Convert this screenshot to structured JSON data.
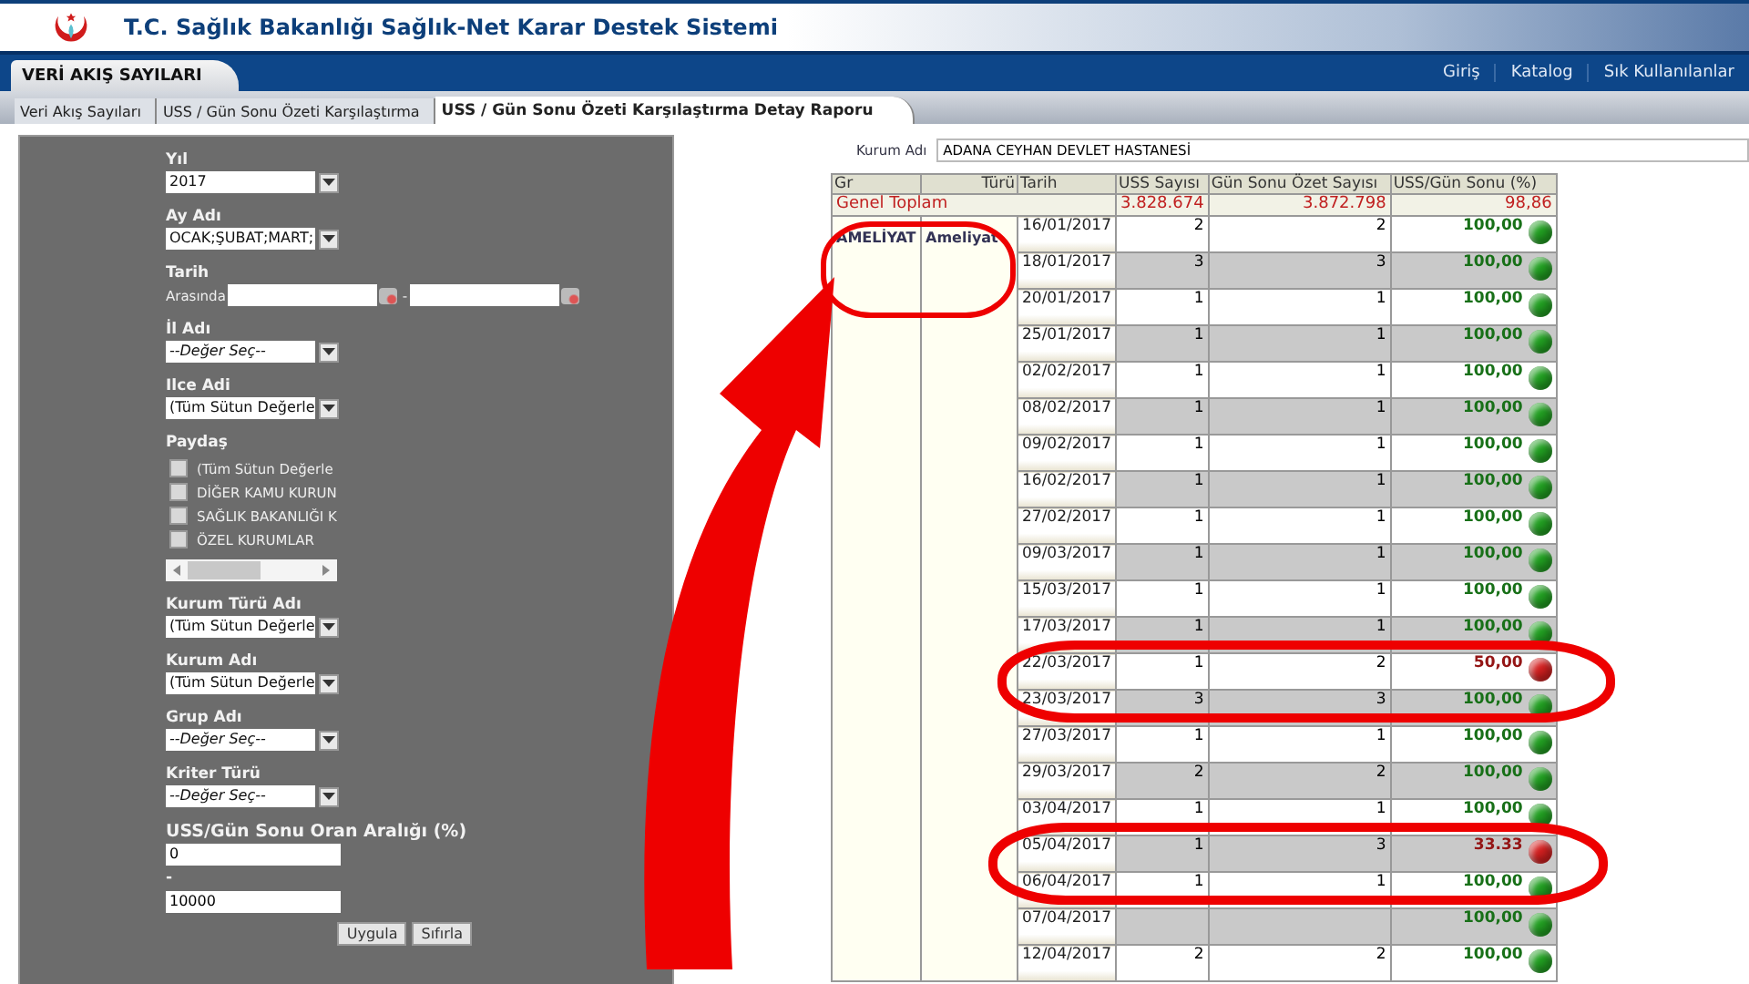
{
  "header": {
    "title": "T.C. Sağlık Bakanlığı Sağlık-Net Karar Destek Sistemi"
  },
  "nav": {
    "section_tab": "VERİ AKIŞ SAYILARI",
    "links": [
      "Giriş",
      "Katalog",
      "Sık Kullanılanlar"
    ]
  },
  "tabs": [
    {
      "label": "Veri Akış Sayıları",
      "selected": false
    },
    {
      "label": "USS / Gün Sonu Özeti Karşılaştırma",
      "selected": false
    },
    {
      "label": "USS / Gün Sonu Özeti Karşılaştırma Detay Raporu",
      "selected": true
    }
  ],
  "filters": [
    {
      "kind": "select",
      "label": "Yıl",
      "value": "2017"
    },
    {
      "kind": "select",
      "label": "Ay Adı",
      "value": "OCAK;ŞUBAT;MART;"
    },
    {
      "kind": "daterange",
      "label": "Tarih",
      "prefix": "Arasında",
      "separator": "-"
    },
    {
      "kind": "select",
      "label": "İl Adı",
      "placeholder": "--Değer Seç--"
    },
    {
      "kind": "select",
      "label": "Ilce Adi",
      "value": "(Tüm Sütun Değerle"
    },
    {
      "kind": "checklist",
      "label": "Paydaş",
      "options": [
        {
          "label": "(Tüm Sütun Değerle",
          "checked": false
        },
        {
          "label": "DİĞER KAMU KURUN",
          "checked": false
        },
        {
          "label": "SAĞLIK BAKANLIĞI K",
          "checked": false
        },
        {
          "label": "ÖZEL KURUMLAR",
          "checked": false
        }
      ]
    },
    {
      "kind": "select",
      "label": "Kurum Türü Adı",
      "value": "(Tüm Sütun Değerle"
    },
    {
      "kind": "select",
      "label": "Kurum Adı",
      "value": "(Tüm Sütun Değerle"
    },
    {
      "kind": "select",
      "label": "Grup Adı",
      "placeholder": "--Değer Seç--"
    },
    {
      "kind": "select",
      "label": "Kriter Türü",
      "placeholder": "--Değer Seç--"
    },
    {
      "kind": "range",
      "label": "USS/Gün Sonu Oran Aralığı (%)",
      "from": "0",
      "separator": "-",
      "to": "10000"
    }
  ],
  "buttons": [
    "Uygula",
    "Sıfırla"
  ],
  "report": {
    "kurum_label": "Kurum Adı",
    "kurum_value": "ADANA CEYHAN DEVLET HASTANESİ",
    "columns": [
      "Gr",
      "Türü",
      "Tarih",
      "USS Sayısı",
      "Gün Sonu Özet Sayısı",
      "USS/Gün Sonu (%)"
    ],
    "total": {
      "label": "Genel Toplam",
      "uss": "3.828.674",
      "ozet": "3.872.798",
      "oran": "98,86"
    },
    "group": "AMELİYAT",
    "kurum_turu": "Ameliyat",
    "rows": [
      {
        "date": "16/01/2017",
        "uss": "2",
        "ozet": "2",
        "oran": "100,00",
        "color": "#22a022"
      },
      {
        "date": "18/01/2017",
        "uss": "3",
        "ozet": "3",
        "oran": "100,00",
        "color": "#22a022"
      },
      {
        "date": "20/01/2017",
        "uss": "1",
        "ozet": "1",
        "oran": "100,00",
        "color": "#22a022"
      },
      {
        "date": "25/01/2017",
        "uss": "1",
        "ozet": "1",
        "oran": "100,00",
        "color": "#22a022"
      },
      {
        "date": "02/02/2017",
        "uss": "1",
        "ozet": "1",
        "oran": "100,00",
        "color": "#22a022"
      },
      {
        "date": "08/02/2017",
        "uss": "1",
        "ozet": "1",
        "oran": "100,00",
        "color": "#22a022"
      },
      {
        "date": "09/02/2017",
        "uss": "1",
        "ozet": "1",
        "oran": "100,00",
        "color": "#22a022"
      },
      {
        "date": "16/02/2017",
        "uss": "1",
        "ozet": "1",
        "oran": "100,00",
        "color": "#22a022"
      },
      {
        "date": "27/02/2017",
        "uss": "1",
        "ozet": "1",
        "oran": "100,00",
        "color": "#22a022"
      },
      {
        "date": "09/03/2017",
        "uss": "1",
        "ozet": "1",
        "oran": "100,00",
        "color": "#22a022"
      },
      {
        "date": "15/03/2017",
        "uss": "1",
        "ozet": "1",
        "oran": "100,00",
        "color": "#22a022"
      },
      {
        "date": "17/03/2017",
        "uss": "1",
        "ozet": "1",
        "oran": "100,00",
        "color": "#22a022"
      },
      {
        "date": "22/03/2017",
        "uss": "1",
        "ozet": "2",
        "oran": "50,00",
        "color": "#d42020"
      },
      {
        "date": "23/03/2017",
        "uss": "3",
        "ozet": "3",
        "oran": "100,00",
        "color": "#22a022"
      },
      {
        "date": "27/03/2017",
        "uss": "1",
        "ozet": "1",
        "oran": "100,00",
        "color": "#22a022"
      },
      {
        "date": "29/03/2017",
        "uss": "2",
        "ozet": "2",
        "oran": "100,00",
        "color": "#22a022"
      },
      {
        "date": "03/04/2017",
        "uss": "1",
        "ozet": "1",
        "oran": "100,00",
        "color": "#22a022"
      },
      {
        "date": "05/04/2017",
        "uss": "1",
        "ozet": "3",
        "oran": "33.33",
        "color": "#d42020"
      },
      {
        "date": "06/04/2017",
        "uss": "1",
        "ozet": "1",
        "oran": "100,00",
        "color": "#22a022"
      },
      {
        "date": "07/04/2017",
        "oran": "100,00",
        "color": "#22a022"
      },
      {
        "date": "12/04/2017",
        "uss": "2",
        "ozet": "2",
        "oran": "100,00",
        "color": "#22a022"
      }
    ]
  }
}
